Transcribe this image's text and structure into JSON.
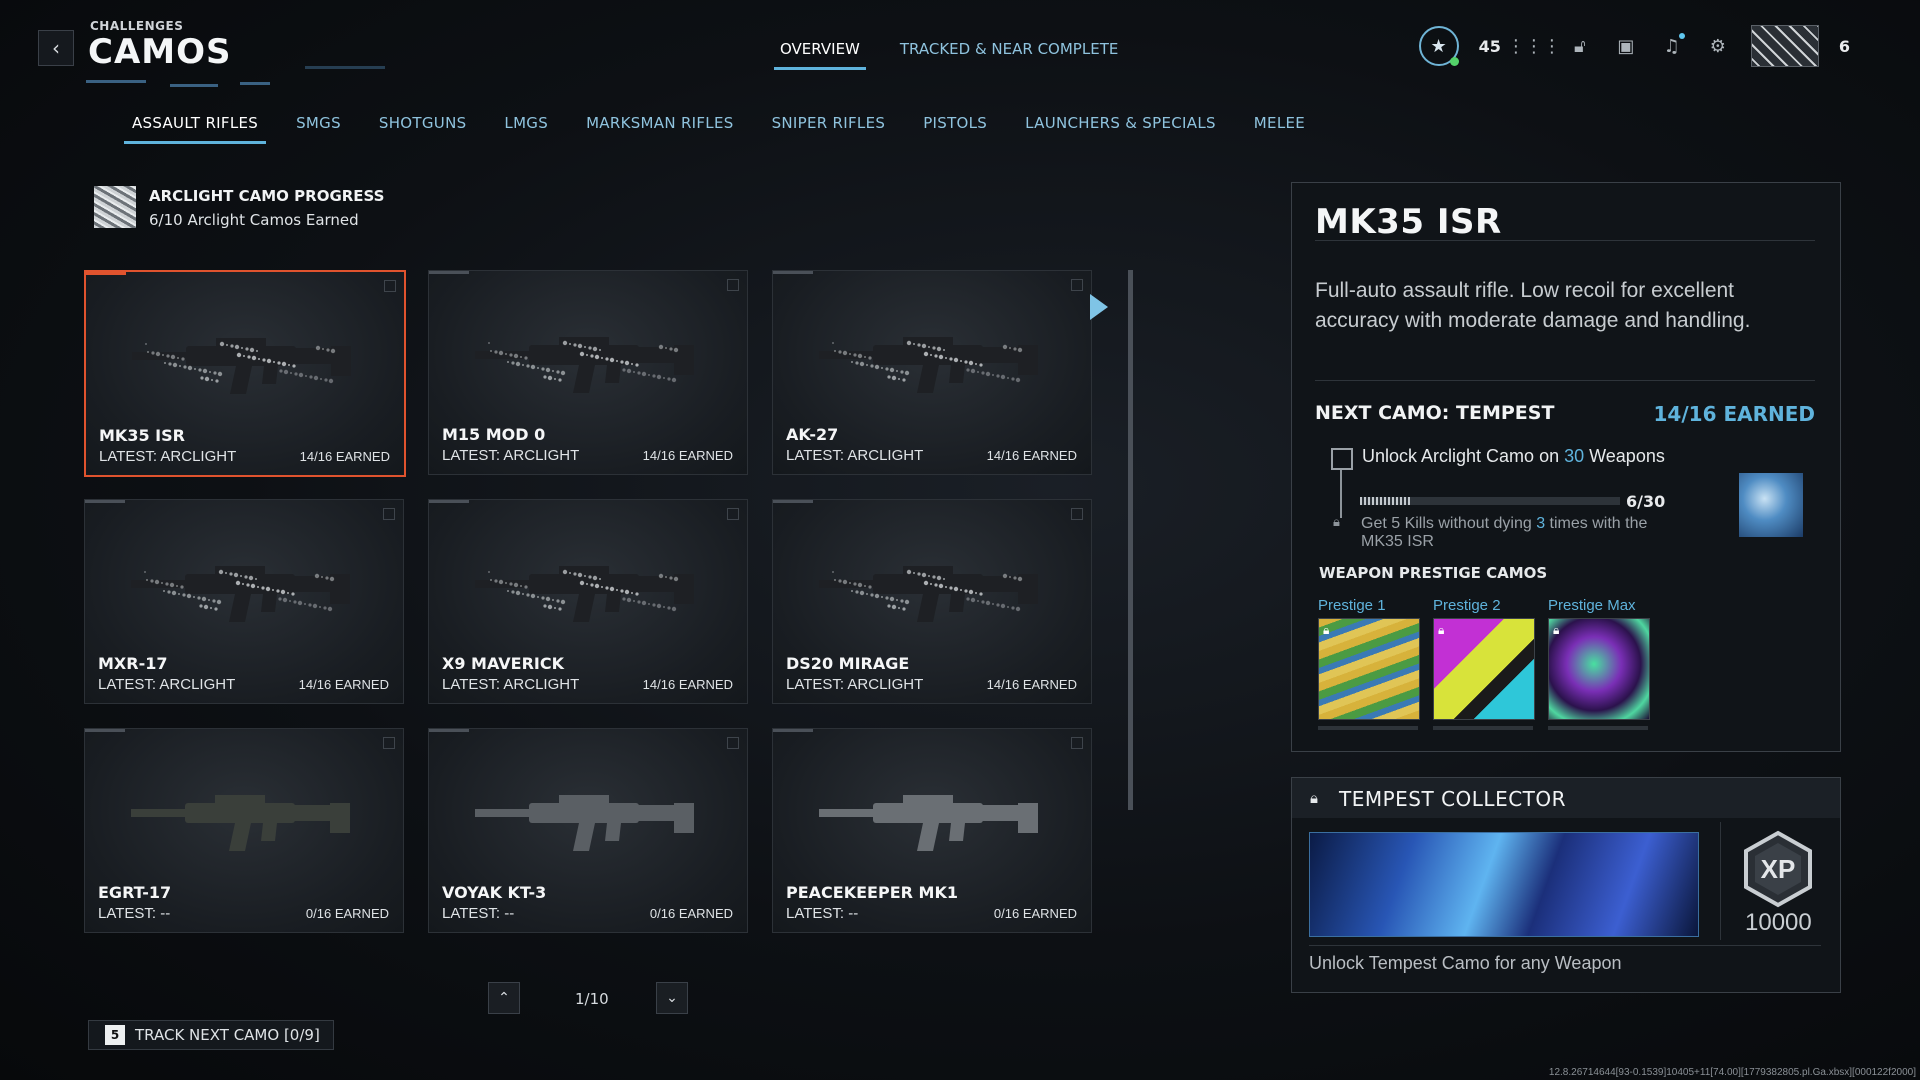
{
  "header": {
    "subtitle": "CHALLENGES",
    "title": "CAMOS",
    "tabs": [
      {
        "label": "OVERVIEW",
        "active": true
      },
      {
        "label": "TRACKED & NEAR COMPLETE",
        "active": false
      }
    ],
    "rank_value": "45",
    "player_count": "6"
  },
  "categories": [
    {
      "label": "ASSAULT RIFLES",
      "active": true
    },
    {
      "label": "SMGS"
    },
    {
      "label": "SHOTGUNS"
    },
    {
      "label": "LMGS"
    },
    {
      "label": "MARKSMAN RIFLES"
    },
    {
      "label": "SNIPER RIFLES"
    },
    {
      "label": "PISTOLS"
    },
    {
      "label": "LAUNCHERS & SPECIALS"
    },
    {
      "label": "MELEE"
    }
  ],
  "progress": {
    "title": "ARCLIGHT CAMO PROGRESS",
    "subtitle": "6/10 Arclight Camos Earned"
  },
  "weapons": [
    {
      "name": "MK35 ISR",
      "latest": "LATEST: ARCLIGHT",
      "earned": "14/16 EARNED",
      "camo": "dark",
      "selected": true
    },
    {
      "name": "M15 MOD 0",
      "latest": "LATEST: ARCLIGHT",
      "earned": "14/16 EARNED",
      "camo": "dark"
    },
    {
      "name": "AK-27",
      "latest": "LATEST: ARCLIGHT",
      "earned": "14/16 EARNED",
      "camo": "dark"
    },
    {
      "name": "MXR-17",
      "latest": "LATEST: ARCLIGHT",
      "earned": "14/16 EARNED",
      "camo": "dark"
    },
    {
      "name": "X9 MAVERICK",
      "latest": "LATEST: ARCLIGHT",
      "earned": "14/16 EARNED",
      "camo": "dark"
    },
    {
      "name": "DS20 MIRAGE",
      "latest": "LATEST: ARCLIGHT",
      "earned": "14/16 EARNED",
      "camo": "dark"
    },
    {
      "name": "EGRT-17",
      "latest": "LATEST: --",
      "earned": "0/16 EARNED",
      "camo": "plain"
    },
    {
      "name": "VOYAK KT-3",
      "latest": "LATEST: --",
      "earned": "0/16 EARNED",
      "camo": "plain"
    },
    {
      "name": "PEACEKEEPER MK1",
      "latest": "LATEST: --",
      "earned": "0/16 EARNED",
      "camo": "plain"
    }
  ],
  "pagination": {
    "page": "1/10"
  },
  "track_button": {
    "key": "5",
    "label": "TRACK NEXT CAMO [0/9]"
  },
  "detail": {
    "name": "MK35 ISR",
    "description": "Full-auto assault rifle. Low recoil for excellent accuracy with moderate damage and handling.",
    "next_camo_label": "NEXT CAMO: TEMPEST",
    "next_camo_earned": "14/16 EARNED",
    "challenge_prefix": "Unlock Arclight Camo on ",
    "challenge_count": "30",
    "challenge_suffix": " Weapons",
    "challenge_progress": "6/30",
    "challenge_progress_fraction": 0.2,
    "sub_prefix": "Get 5 Kills without dying ",
    "sub_count": "3",
    "sub_suffix": " times with the MK35 ISR",
    "prestige_title": "WEAPON PRESTIGE CAMOS",
    "prestige": [
      {
        "label": "Prestige 1"
      },
      {
        "label": "Prestige 2"
      },
      {
        "label": "Prestige Max"
      }
    ]
  },
  "collector": {
    "title": "TEMPEST COLLECTOR",
    "xp_label": "XP",
    "xp_value": "10000",
    "description": "Unlock Tempest Camo for any Weapon"
  },
  "footer_debug": "12.8.26714644[93-0.1539]10405+11[74.00][1779382805.pl.Ga.xbsx][000122f2000]",
  "colors": {
    "accent": "#5fb3dc",
    "selected_border": "#e0532e",
    "online": "#54d26a"
  }
}
